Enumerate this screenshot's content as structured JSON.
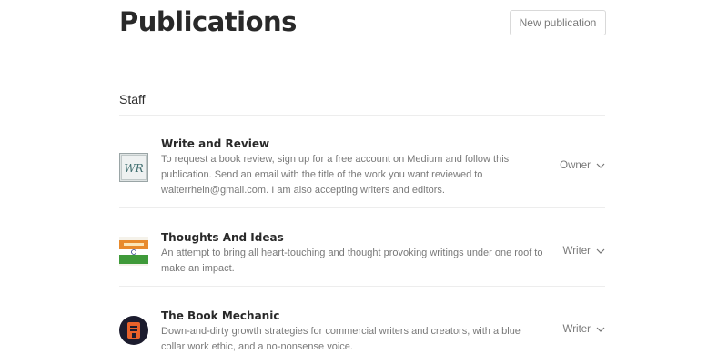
{
  "header": {
    "title": "Publications",
    "new_publication_label": "New publication"
  },
  "section": {
    "label": "Staff"
  },
  "publications": [
    {
      "name": "Write and Review",
      "description": "To request a book review, sign up for a free account on Medium and follow this publication. Send an email with the title of the work you want reviewed to walterrhein@gmail.com. I am also accepting writers and editors.",
      "role": "Owner",
      "avatar_icon": "write-and-review-logo",
      "avatar_text": "WR"
    },
    {
      "name": "Thoughts And Ideas",
      "description": "An attempt to bring all heart-touching and thought provoking writings under one roof to make an impact.",
      "role": "Writer",
      "avatar_icon": "thoughts-and-ideas-logo"
    },
    {
      "name": "The Book Mechanic",
      "description": "Down-and-dirty growth strategies for commercial writers and creators, with a blue collar work ethic, and a no-nonsense voice.",
      "role": "Writer",
      "avatar_icon": "book-mechanic-logo"
    }
  ],
  "colors": {
    "primary_text": "#1f1f1f",
    "secondary_text": "#757575",
    "divider": "#ededed",
    "button_border": "#d9d9d9"
  }
}
